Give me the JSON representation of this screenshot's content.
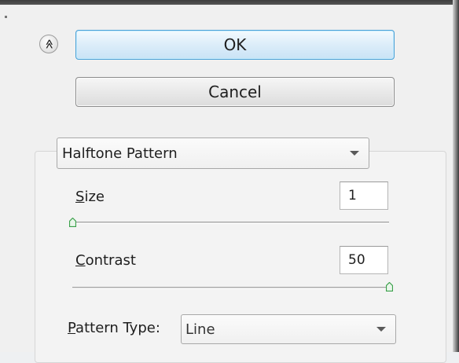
{
  "dialog": {
    "ok_label": "OK",
    "cancel_label": "Cancel",
    "collapse_glyph": "≫"
  },
  "filter_select": {
    "value": "Halftone Pattern"
  },
  "controls": {
    "size": {
      "label_first": "S",
      "label_rest": "ize",
      "value": "1",
      "slider_fraction": 0.0
    },
    "contrast": {
      "label_first": "C",
      "label_rest": "ontrast",
      "value": "50",
      "slider_fraction": 1.0
    },
    "pattern_type": {
      "label_first": "P",
      "label_rest": "attern Type:",
      "value": "Line"
    }
  },
  "colors": {
    "ok_border": "#4aa0d6",
    "slider_thumb": "#3aa04a"
  },
  "icons": {
    "collapse": "double-chevron-up-icon",
    "dropdown": "chevron-down-icon",
    "slider_thumb": "slider-thumb-icon"
  }
}
